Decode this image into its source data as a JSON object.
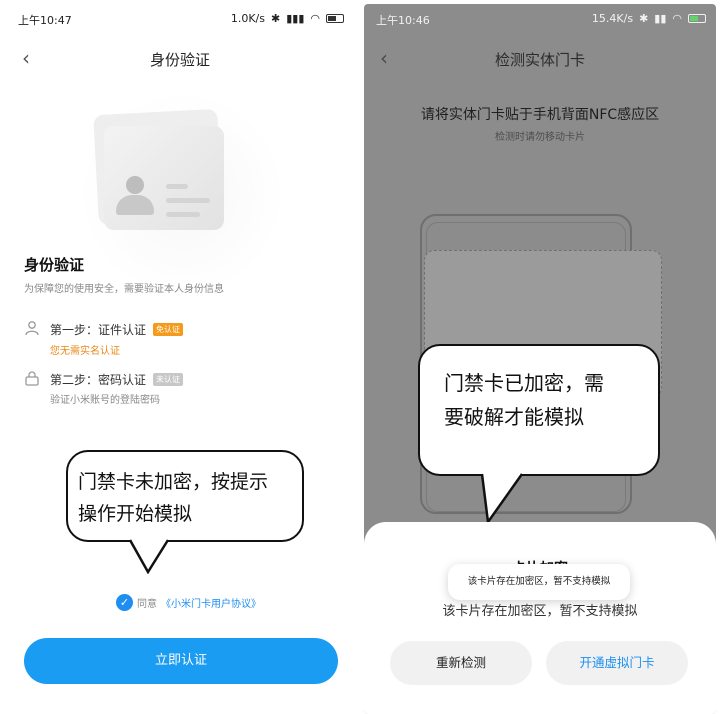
{
  "left": {
    "status": {
      "time": "上午10:47",
      "speed": "1.0K/s"
    },
    "title": "身份验证",
    "section_title": "身份验证",
    "section_sub": "为保障您的使用安全，需要验证本人身份信息",
    "step1": {
      "label": "第一步：证件认证",
      "badge": "免认证",
      "desc": "您无需实名认证"
    },
    "step2": {
      "label": "第二步：密码认证",
      "badge": "未认证",
      "desc": "验证小米账号的登陆密码"
    },
    "bubble": {
      "line1": "门禁卡未加密，按提示",
      "line2": "操作开始模拟"
    },
    "agree_prefix": "同意",
    "agree_link": "《小米门卡用户协议》",
    "primary_button": "立即认证"
  },
  "right": {
    "status": {
      "time": "上午10:46",
      "speed": "15.4K/s"
    },
    "title": "检测实体门卡",
    "nfc_title": "请将实体门卡贴于手机背面NFC感应区",
    "nfc_sub": "检测时请勿移动卡片",
    "bubble": {
      "line1": "门禁卡已加密，需",
      "line2": "要破解才能模拟"
    },
    "sheet_title": "卡片加密",
    "sheet_desc": "该卡片存在加密区，暂不支持模拟",
    "toast": "该卡片存在加密区，暂不支持模拟",
    "button_retry": "重新检测",
    "button_virtual": "开通虚拟门卡"
  },
  "colors": {
    "accent": "#1a9cf3",
    "badge_orange": "#f59a1b",
    "overlay": "#8c8c8c"
  }
}
